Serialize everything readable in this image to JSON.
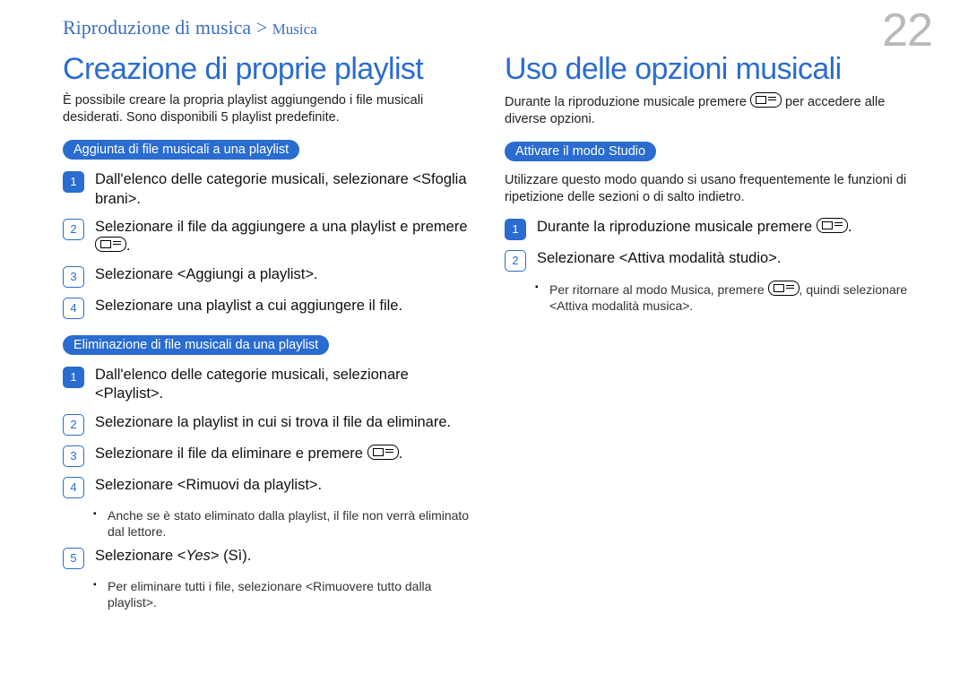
{
  "breadcrumb": {
    "main": "Riproduzione di musica",
    "sep": ">",
    "sub": "Musica"
  },
  "page_number": "22",
  "left": {
    "title": "Creazione di proprie playlist",
    "intro": "È possibile creare la propria playlist aggiungendo i file musicali desiderati. Sono disponibili 5 playlist predefinite.",
    "section1": {
      "pill": "Aggiunta di file musicali a una playlist",
      "steps": [
        "Dall'elenco delle categorie musicali, selezionare <Sfoglia brani>.",
        "Selezionare il file da aggiungere a una playlist e premere ",
        "Selezionare <Aggiungi a playlist>.",
        "Selezionare una playlist a cui aggiungere il file."
      ],
      "step2_tail": "."
    },
    "section2": {
      "pill": "Eliminazione di file musicali da una playlist",
      "steps": [
        "Dall'elenco delle categorie musicali, selezionare <Playlist>.",
        "Selezionare la playlist in cui si trova il file da eliminare.",
        "Selezionare il file da eliminare e premere ",
        "Selezionare <Rimuovi da playlist>.",
        "Selezionare <"
      ],
      "step3_tail": ".",
      "step5_italic": "Yes",
      "step5_tail": "> (Sì).",
      "note1": "Anche se è stato eliminato dalla playlist, il file non verrà eliminato dal lettore.",
      "note2": "Per eliminare tutti i file, selezionare <Rimuovere tutto dalla playlist>."
    }
  },
  "right": {
    "title": "Uso delle opzioni musicali",
    "intro_a": "Durante la riproduzione musicale premere ",
    "intro_b": " per accedere alle diverse opzioni.",
    "section1": {
      "pill": "Attivare il modo Studio",
      "desc": "Utilizzare questo modo quando si usano frequentemente le funzioni di ripetizione delle sezioni o di salto indietro.",
      "step1_a": "Durante la riproduzione musicale premere ",
      "step1_b": ".",
      "step2": "Selezionare <Attiva modalità studio>.",
      "note_a": "Per ritornare al modo Musica, premere ",
      "note_b": ", quindi selezionare <Attiva modalità musica>."
    }
  }
}
